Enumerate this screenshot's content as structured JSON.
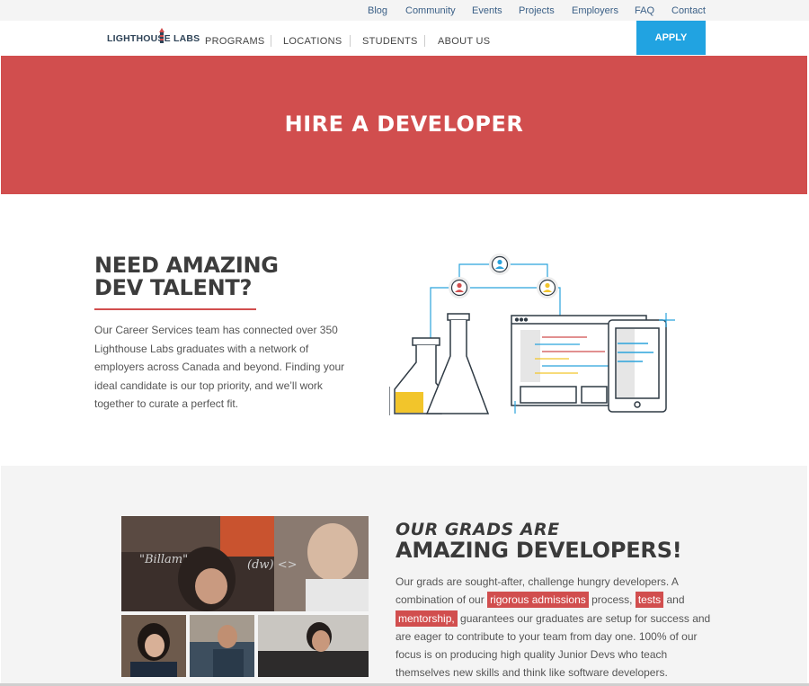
{
  "topbar": {
    "links": [
      "Blog",
      "Community",
      "Events",
      "Projects",
      "Employers",
      "FAQ",
      "Contact"
    ]
  },
  "nav": {
    "logo": "LIGHTHOUSE LABS",
    "items": [
      "PROGRAMS",
      "LOCATIONS",
      "STUDENTS",
      "ABOUT US"
    ],
    "apply": "APPLY"
  },
  "hero": {
    "title": "HIRE A DEVELOPER"
  },
  "talent": {
    "title_line1": "NEED AMAZING",
    "title_line2": "DEV TALENT?",
    "body": "Our Career Services team has connected over 350 Lighthouse Labs graduates with a network of employers across Canada and beyond. Finding your ideal candidate is our top priority, and we’ll work together to curate a perfect fit."
  },
  "grads": {
    "subtitle": "OUR GRADS ARE",
    "title": "AMAZING DEVELOPERS!",
    "body_1": "Our grads are sought-after, challenge hungry developers. A combination of our ",
    "highlight_1": "rigorous admissions",
    "body_2": " process, ",
    "highlight_2": "tests",
    "body_3": " and ",
    "highlight_3": "mentorship,",
    "body_4": " guarantees our graduates are setup for success and are eager to contribute to your team from day one. 100% of our focus is on producing high quality Junior Devs who teach themselves new skills and think like software developers."
  },
  "colors": {
    "brand_red": "#d14e4e",
    "apply_blue": "#21a3e1",
    "link_blue": "#3a5f86"
  }
}
